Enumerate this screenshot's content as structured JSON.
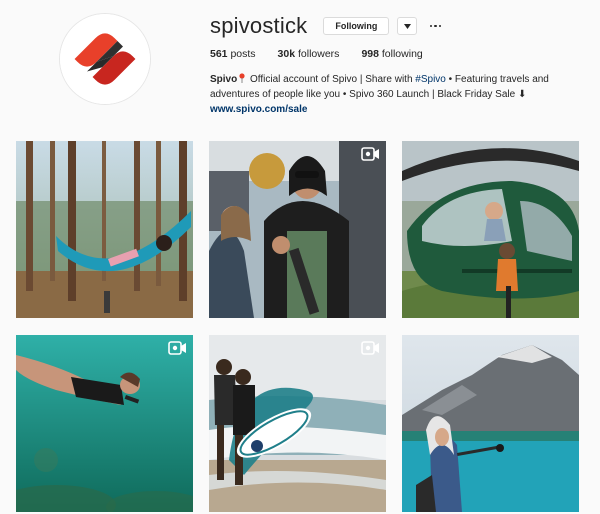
{
  "profile": {
    "username": "spivostick",
    "following_label": "Following",
    "stats": [
      {
        "count": "561",
        "label": " posts"
      },
      {
        "count": "30k",
        "label": " followers"
      },
      {
        "count": "998",
        "label": " following"
      }
    ],
    "bio": {
      "name": "Spivo",
      "text1": " Official account of Spivo | Share with ",
      "hashtag": "#Spivo",
      "text2": " • Featuring travels and adventures of people like you • Spivo 360 Launch | Black Friday Sale ⬇",
      "link": "www.spivo.com/sale"
    }
  },
  "posts": [
    {
      "name": "hammock-forest",
      "has_video": false
    },
    {
      "name": "couple-selfie-street",
      "has_video": true
    },
    {
      "name": "helicopter-selfie",
      "has_video": false
    },
    {
      "name": "underwater-swim",
      "has_video": true
    },
    {
      "name": "surfers-beach",
      "has_video": true
    },
    {
      "name": "mountain-lake-selfie",
      "has_video": false
    }
  ],
  "colors": {
    "brand_red": "#e8402a",
    "brand_dark": "#2a2a2a",
    "link": "#003569"
  }
}
